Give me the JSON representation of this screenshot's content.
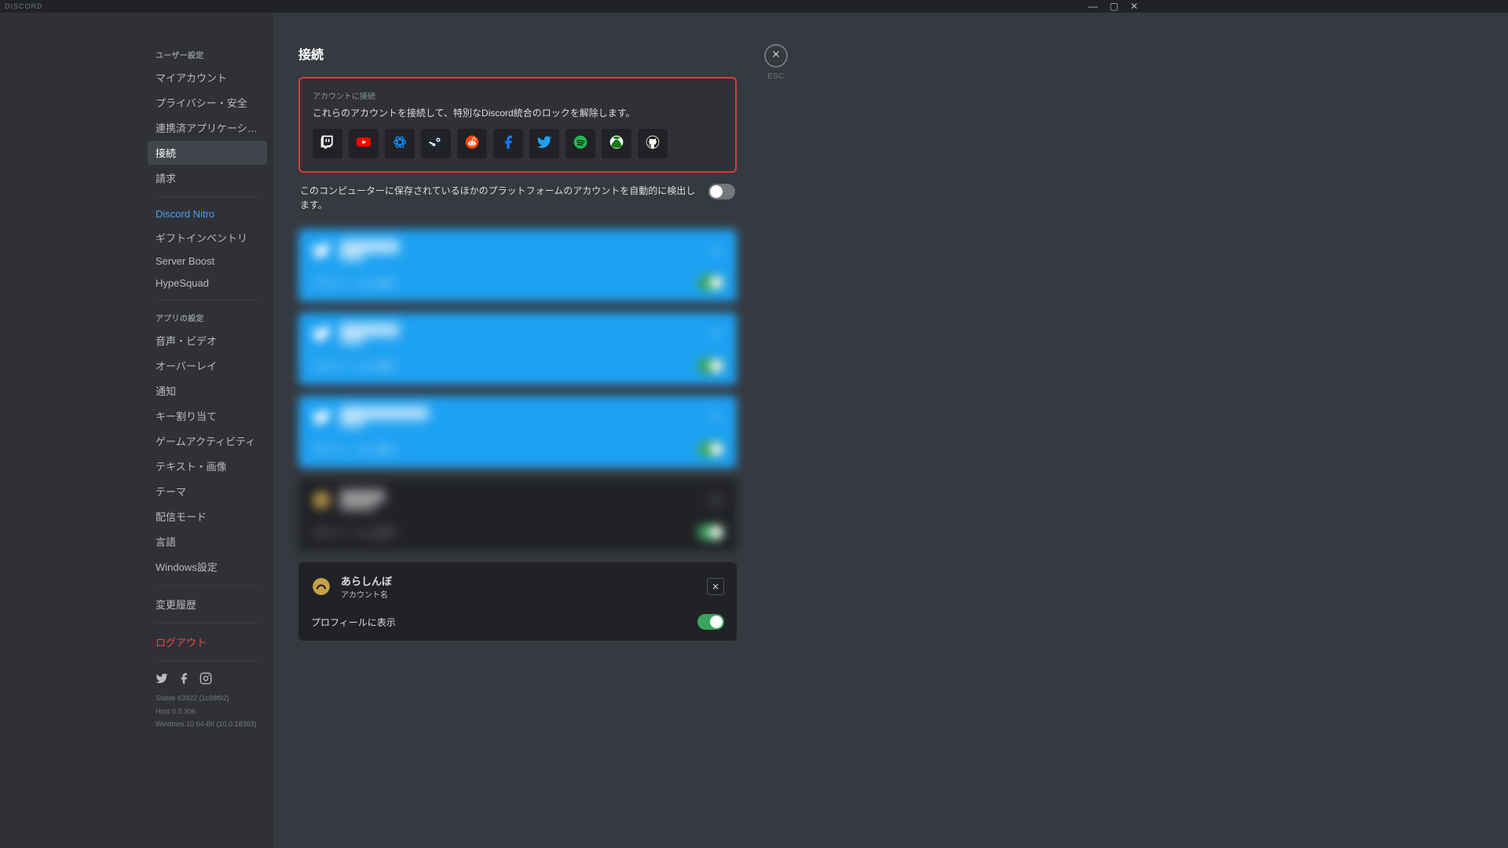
{
  "titlebar": {
    "app_name": "DISCORD"
  },
  "close": {
    "label": "ESC"
  },
  "sidebar": {
    "section_user": "ユーザー設定",
    "user_items": [
      "マイアカウント",
      "プライバシー・安全",
      "連携済アプリケーショ…",
      "接続",
      "請求"
    ],
    "nitro_items": [
      "Discord Nitro",
      "ギフトインベントリ",
      "Server Boost",
      "HypeSquad"
    ],
    "section_app": "アプリの設定",
    "app_items": [
      "音声・ビデオ",
      "オーバーレイ",
      "通知",
      "キー割り当て",
      "ゲームアクティビティ",
      "テキスト・画像",
      "テーマ",
      "配信モード",
      "言語",
      "Windows設定"
    ],
    "changelog": "変更履歴",
    "logout": "ログアウト",
    "version_lines": [
      "Stable 63922 (1c88f92)",
      "Host 0.0.306",
      "Windows 10 64-Bit (10.0.18363)"
    ]
  },
  "content": {
    "title": "接続",
    "connect_panel": {
      "title": "アカウントに接続",
      "desc": "これらのアカウントを接続して、特別なDiscord統合のロックを解除します。",
      "services": [
        "twitch",
        "youtube",
        "battlenet",
        "steam",
        "reddit",
        "facebook",
        "twitter",
        "spotify",
        "xbox",
        "github"
      ]
    },
    "autodetect": "このコンピューターに保存されているほかのプラットフォームのアカウントを自動的に検出します。",
    "profile_label": "プロフィールに表示",
    "connections": [
      {
        "color": "blue",
        "blurred": true,
        "name": "████████",
        "sub": "████",
        "toggle": true
      },
      {
        "color": "blue",
        "blurred": true,
        "name": "████████",
        "sub": "████",
        "toggle": true
      },
      {
        "color": "blue",
        "blurred": true,
        "name": "████████████",
        "sub": "████",
        "toggle": true
      },
      {
        "color": "dark",
        "blurred": true,
        "name": "██████",
        "sub": "██████",
        "toggle": true
      },
      {
        "color": "dark",
        "blurred": false,
        "name": "あらしんぼ",
        "sub": "アカウント名",
        "toggle": true
      }
    ]
  }
}
